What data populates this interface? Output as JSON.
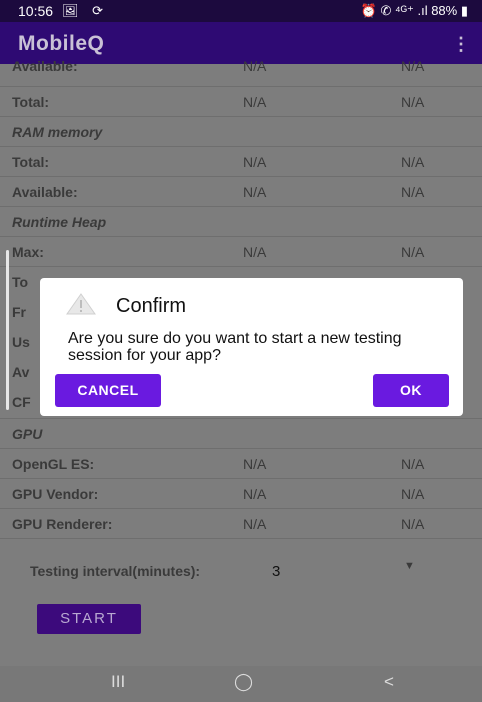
{
  "status_bar": {
    "time": "10:56",
    "left_icons": "🖼 ⟳",
    "right_text": "⏰ ✆ ⁴ᴳ⁺ .ıl 88% ▮"
  },
  "app_bar": {
    "title": "MobileQ",
    "menu_icon": "⋮"
  },
  "rows": [
    {
      "label": "Available:",
      "v1": "N/A",
      "v2": "N/A"
    },
    {
      "label": "Total:",
      "v1": "N/A",
      "v2": "N/A"
    },
    {
      "label": "RAM memory",
      "v1": "",
      "v2": ""
    },
    {
      "label": "Total:",
      "v1": "N/A",
      "v2": "N/A"
    },
    {
      "label": "Available:",
      "v1": "N/A",
      "v2": "N/A"
    },
    {
      "label": "Runtime Heap",
      "v1": "",
      "v2": ""
    },
    {
      "label": "Max:",
      "v1": "N/A",
      "v2": "N/A"
    },
    {
      "label": "To",
      "v1": "",
      "v2": ""
    },
    {
      "label": "Fr",
      "v1": "",
      "v2": ""
    },
    {
      "label": "Us",
      "v1": "",
      "v2": ""
    },
    {
      "label": "Av",
      "v1": "",
      "v2": ""
    },
    {
      "label": "CF",
      "v1": "",
      "v2": ""
    },
    {
      "label": "GPU",
      "v1": "",
      "v2": ""
    },
    {
      "label": "OpenGL ES:",
      "v1": "N/A",
      "v2": "N/A"
    },
    {
      "label": "GPU Vendor:",
      "v1": "N/A",
      "v2": "N/A"
    },
    {
      "label": "GPU Renderer:",
      "v1": "N/A",
      "v2": "N/A"
    }
  ],
  "interval": {
    "label": "Testing interval(minutes):",
    "value": "3",
    "arrow": "▼"
  },
  "start_button": "START",
  "dialog": {
    "title": "Confirm",
    "message": "Are you sure do you want to start a new testing session for your app?",
    "cancel": "CANCEL",
    "ok": "OK"
  },
  "nav": {
    "recents": "III",
    "home": "◯",
    "back": "<"
  }
}
